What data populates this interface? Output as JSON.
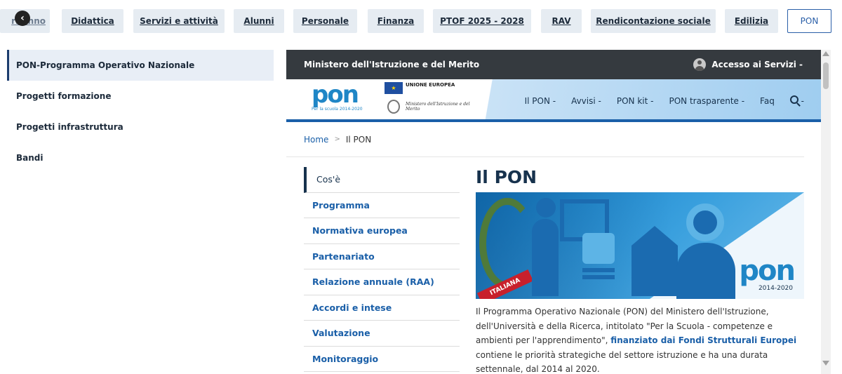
{
  "topnav": {
    "tabs": [
      {
        "label": "ri Anno",
        "state": "faded"
      },
      {
        "label": "Didattica",
        "state": "normal"
      },
      {
        "label": "Servizi e attività",
        "state": "normal"
      },
      {
        "label": "Alunni",
        "state": "normal"
      },
      {
        "label": "Personale",
        "state": "normal"
      },
      {
        "label": "Finanza",
        "state": "normal"
      },
      {
        "label": "PTOF 2025 - 2028",
        "state": "normal"
      },
      {
        "label": "RAV",
        "state": "normal"
      },
      {
        "label": "Rendicontazione sociale",
        "state": "normal"
      },
      {
        "label": "Edilizia",
        "state": "normal"
      },
      {
        "label": "PON",
        "state": "active"
      }
    ],
    "back_icon": "chevron-left-icon"
  },
  "sidebar": {
    "items": [
      {
        "label": "PON-Programma Operativo Nazionale",
        "active": true
      },
      {
        "label": "Progetti formazione",
        "active": false
      },
      {
        "label": "Progetti infrastruttura",
        "active": false
      },
      {
        "label": "Bandi",
        "active": false
      }
    ]
  },
  "frame": {
    "ministry_bar": "Ministero dell'Istruzione e del Merito",
    "access_label": "Accesso ai Servizi -",
    "logo": {
      "pon_text": "pon",
      "pon_sub": "Per la scuola 2014-2020",
      "eu_text": "UNIONE EUROPEA",
      "ministero_text": "Ministero dell'Istruzione e del Merito"
    },
    "menu": [
      "Il PON -",
      "Avvisi -",
      "PON kit -",
      "PON trasparente -",
      "Faq"
    ],
    "search_suffix": "-",
    "breadcrumb": {
      "home": "Home",
      "sep": ">",
      "current": "Il PON"
    },
    "subnav": [
      {
        "label": "Cos'è",
        "active": true
      },
      {
        "label": "Programma",
        "active": false
      },
      {
        "label": "Normativa europea",
        "active": false
      },
      {
        "label": "Partenariato",
        "active": false
      },
      {
        "label": "Relazione annuale (RAA)",
        "active": false
      },
      {
        "label": "Accordi e intese",
        "active": false
      },
      {
        "label": "Valutazione",
        "active": false
      },
      {
        "label": "Monitoraggio",
        "active": false
      }
    ],
    "main": {
      "title": "Il PON",
      "hero_band": "ITALIANA",
      "hero_pon": "pon",
      "hero_years": "2014-2020",
      "para_1": "Il Programma Operativo Nazionale (PON) del Ministero dell'Istruzione, dell'Università e della Ricerca, intitolato \"Per la Scuola - competenze e ambienti per l'apprendimento\", ",
      "para_link": "finanziato dai Fondi Strutturali Europei",
      "para_2": " contiene le priorità strategiche del settore istruzione e ha una durata settennale, dal 2014 al 2020."
    }
  },
  "colors": {
    "accent": "#1a5fa8",
    "dark": "#17324d",
    "bar": "#353a3f",
    "tab_bg": "#e6ecf2"
  }
}
